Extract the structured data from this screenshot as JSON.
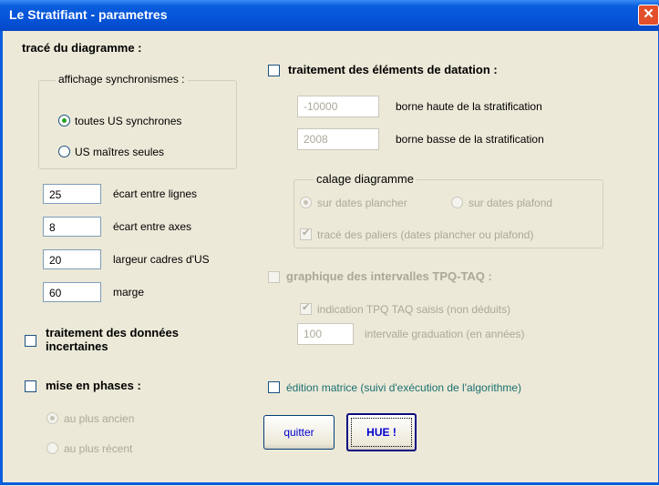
{
  "window": {
    "title": "Le Stratifiant - parametres",
    "close_symbol": "✕"
  },
  "left": {
    "diagram_heading": "tracé du diagramme :",
    "sync_group_label": "affichage synchronismes :",
    "sync_options": [
      "toutes US synchrones",
      "US maîtres seules"
    ],
    "sync_selected": "toutes US synchrones",
    "fields": [
      {
        "value": "25",
        "label": "écart entre lignes"
      },
      {
        "value": "8",
        "label": "écart entre axes"
      },
      {
        "value": "20",
        "label": "largeur cadres d'US"
      },
      {
        "value": "60",
        "label": "marge"
      }
    ],
    "uncertain_label_line1": "traitement des données",
    "uncertain_label_line2": "incertaines",
    "uncertain_checked": false,
    "phases_label": "mise en phases :",
    "phases_checked": false,
    "phases_options": [
      "au plus ancien",
      "au plus récent"
    ],
    "phases_selected": "au plus ancien"
  },
  "right": {
    "dating_label": "traitement des éléments de datation :",
    "dating_checked": false,
    "upper_value": "-10000",
    "upper_label": "borne haute de la stratification",
    "lower_value": "2008",
    "lower_label": "borne basse de la stratification",
    "calage_label": "calage diagramme",
    "calage_options": [
      "sur dates plancher",
      "sur dates plafond"
    ],
    "calage_selected": "sur dates plancher",
    "paliers_label": "tracé des paliers (dates plancher ou plafond)",
    "paliers_checked": true,
    "tpq_label": "graphique des intervalles TPQ-TAQ :",
    "tpq_checked": false,
    "tpq_indication_label": "indication TPQ TAQ saisis (non déduits)",
    "tpq_indication_checked": true,
    "interval_value": "100",
    "interval_label": "intervalle graduation (en années)",
    "matrix_label": "édition matrice (suivi d'exécution de l'algorithme)",
    "matrix_checked": false,
    "quit_label": "quitter",
    "hue_label": "HUE !"
  }
}
